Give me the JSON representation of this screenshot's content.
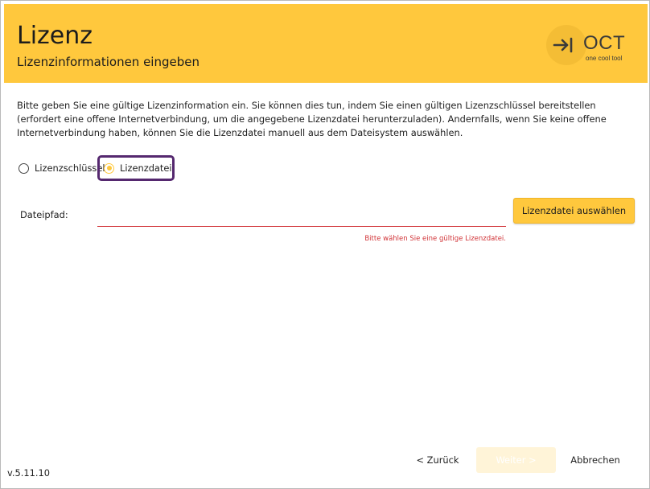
{
  "header": {
    "title": "Lizenz",
    "subtitle": "Lizenzinformationen eingeben",
    "logo": {
      "text": "OCT",
      "tagline": "one cool tool",
      "icon": "arrow-right-bar-icon"
    }
  },
  "description": "Bitte geben Sie eine gültige Lizenzinformation ein. Sie können dies tun, indem Sie einen gültigen Lizenzschlüssel bereitstellen (erfordert eine offene Internetverbindung, um die angegebene Lizenzdatei herunterzuladen). Andernfalls, wenn Sie keine offene Internetverbindung haben, können Sie die Lizenzdatei manuell aus dem Dateisystem auswählen.",
  "license_type": {
    "options": [
      {
        "label": "Lizenzschlüssel",
        "checked": false
      },
      {
        "label": "Lizenzdatei",
        "checked": true
      }
    ]
  },
  "file_path": {
    "label": "Dateipfad:",
    "value": "",
    "error": "Bitte wählen Sie eine gültige Lizenzdatei.",
    "select_button": "Lizenzdatei auswählen"
  },
  "footer": {
    "version": "v.5.11.10",
    "back_button": "< Zurück",
    "next_button": "Weiter >",
    "cancel_button": "Abbrechen"
  },
  "colors": {
    "accent": "#ffc83d",
    "error": "#d13438",
    "focus": "#55286f"
  }
}
